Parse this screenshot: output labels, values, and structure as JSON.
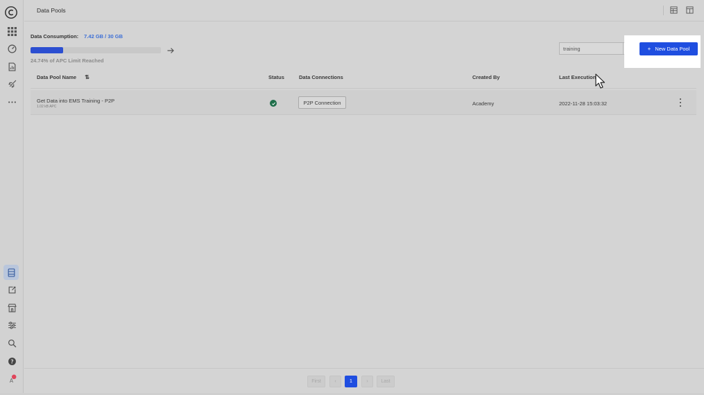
{
  "header": {
    "title": "Data Pools"
  },
  "consumption": {
    "label": "Data Consumption:",
    "value": "7.42 GB / 30 GB",
    "progress_percent": 24.74,
    "note": "24.74% of APC Limit Reached"
  },
  "search": {
    "value": "training"
  },
  "new_button": {
    "plus": "+",
    "label": "New Data Pool"
  },
  "table": {
    "columns": [
      "Data Pool Name",
      "Status",
      "Data Connections",
      "Created By",
      "Last Execution"
    ],
    "sort_icon": "⇅",
    "rows": [
      {
        "name": "Get Data into EMS Training - P2P",
        "size": "1.02 kB APC",
        "status": "success",
        "connection": "P2P Connection",
        "created_by": "Academy",
        "last_execution": "2022-11-28 15:03:32"
      }
    ]
  },
  "pagination": {
    "first": "First",
    "prev": "‹",
    "current": "1",
    "next": "›",
    "last": "Last"
  },
  "colors": {
    "accent": "#1f4ee0",
    "status_success": "#1f6e4a",
    "consumption_value": "#3d6fd6"
  },
  "icons": {
    "sidebar": [
      "celonis-logo-icon",
      "apps-grid-icon",
      "speedometer-icon",
      "document-chart-icon",
      "rocket-icon",
      "more-dots-icon",
      "data-pools-icon",
      "export-icon",
      "store-icon",
      "sliders-icon",
      "search-icon",
      "help-icon",
      "user-icon"
    ],
    "top": [
      "table-view-icon",
      "layout-icon"
    ]
  }
}
